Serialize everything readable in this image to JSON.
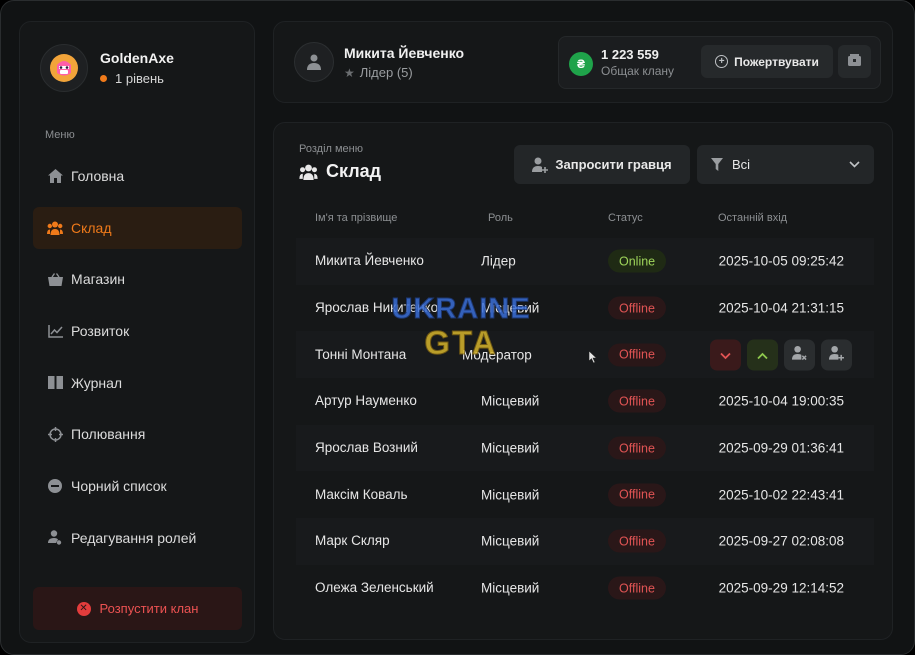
{
  "profile": {
    "name": "GoldenAxe",
    "level": "1 рівень",
    "avatar_icon": "stormtrooper-avatar"
  },
  "sidebar": {
    "caption": "Меню",
    "items": [
      {
        "label": "Головна",
        "icon": "home-icon",
        "active": false
      },
      {
        "label": "Склад",
        "icon": "users-icon",
        "active": true
      },
      {
        "label": "Магазин",
        "icon": "basket-icon",
        "active": false
      },
      {
        "label": "Розвиток",
        "icon": "chart-icon",
        "active": false
      },
      {
        "label": "Журнал",
        "icon": "book-icon",
        "active": false
      },
      {
        "label": "Полювання",
        "icon": "crosshair-icon",
        "active": false
      },
      {
        "label": "Чорний список",
        "icon": "block-icon",
        "active": false
      },
      {
        "label": "Редагування ролей",
        "icon": "user-edit-icon",
        "active": false
      }
    ],
    "disband_label": "Розпустити клан"
  },
  "header": {
    "user_name": "Микита Йевченко",
    "user_role": "Лідер (5)",
    "fund_amount": "1 223 559",
    "fund_caption": "Общак клану",
    "donate_label": "Пожертвувати"
  },
  "section": {
    "caption": "Розділ меню",
    "title": "Склад",
    "invite_label": "Запросити гравця",
    "filter_value": "Всі"
  },
  "table": {
    "columns": [
      "Ім'я та прізвище",
      "Роль",
      "Статус",
      "Останній вхід"
    ],
    "rows": [
      {
        "name": "Микита Йевченко",
        "role": "Лідер",
        "status": "Online",
        "last_login": "2025-10-05 09:25:42"
      },
      {
        "name": "Ярослав Никитенко",
        "role": "Місцевий",
        "status": "Offline",
        "last_login": "2025-10-04 21:31:15"
      },
      {
        "name": "Тонні Монтана",
        "role": "Модератор",
        "status": "Offline",
        "last_login": ""
      },
      {
        "name": "Артур Науменко",
        "role": "Місцевий",
        "status": "Offline",
        "last_login": "2025-10-04 19:00:35"
      },
      {
        "name": "Ярослав Возний",
        "role": "Місцевий",
        "status": "Offline",
        "last_login": "2025-09-29 01:36:41"
      },
      {
        "name": "Максім Коваль",
        "role": "Місцевий",
        "status": "Offline",
        "last_login": "2025-10-02 22:43:41"
      },
      {
        "name": "Марк Скляр",
        "role": "Місцевий",
        "status": "Offline",
        "last_login": "2025-09-27 02:08:08"
      },
      {
        "name": "Олежа Зеленський",
        "role": "Місцевий",
        "status": "Offline",
        "last_login": "2025-09-29 12:14:52"
      }
    ]
  },
  "watermark": {
    "line1": "UKRAINE",
    "line2": "GTA"
  },
  "colors": {
    "accent": "#f07a1a",
    "online": "#9ed45a",
    "offline": "#e05454",
    "coin": "#1fa34a"
  }
}
